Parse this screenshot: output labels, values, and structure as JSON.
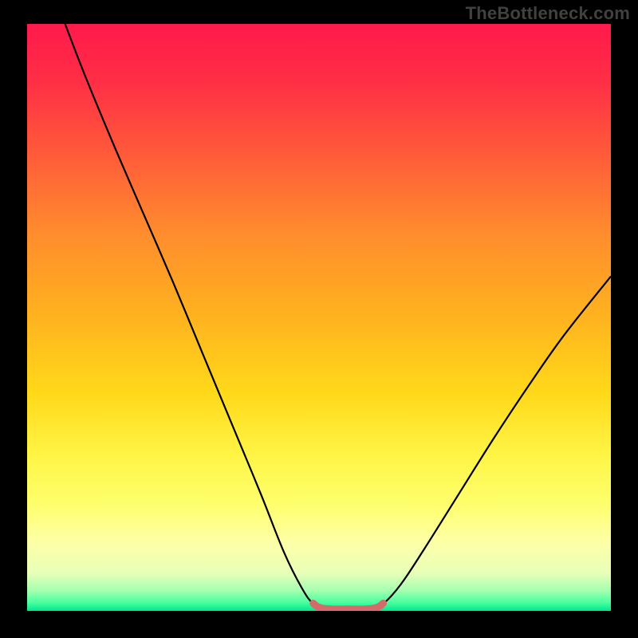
{
  "watermark": "TheBottleneck.com",
  "gradient": {
    "stops": [
      {
        "offset": 0.0,
        "color": "#ff1a4b"
      },
      {
        "offset": 0.1,
        "color": "#ff2f45"
      },
      {
        "offset": 0.22,
        "color": "#ff5a3a"
      },
      {
        "offset": 0.35,
        "color": "#ff8a2e"
      },
      {
        "offset": 0.5,
        "color": "#ffb31f"
      },
      {
        "offset": 0.63,
        "color": "#ffd91a"
      },
      {
        "offset": 0.74,
        "color": "#fff648"
      },
      {
        "offset": 0.82,
        "color": "#feff6e"
      },
      {
        "offset": 0.885,
        "color": "#fdffa8"
      },
      {
        "offset": 0.935,
        "color": "#e8ffb8"
      },
      {
        "offset": 0.965,
        "color": "#a6ffb0"
      },
      {
        "offset": 0.985,
        "color": "#4cffa0"
      },
      {
        "offset": 1.0,
        "color": "#00e88f"
      }
    ]
  },
  "chart_data": {
    "type": "line",
    "title": "",
    "xlabel": "",
    "ylabel": "",
    "xlim": [
      0,
      100
    ],
    "ylim": [
      0,
      100
    ],
    "series": [
      {
        "name": "bottleneck-curve",
        "color": "#000000",
        "width": 2.2,
        "points": [
          {
            "x": 6.5,
            "y": 100.0
          },
          {
            "x": 10.0,
            "y": 91.0
          },
          {
            "x": 15.0,
            "y": 79.0
          },
          {
            "x": 20.0,
            "y": 67.5
          },
          {
            "x": 25.0,
            "y": 56.0
          },
          {
            "x": 30.0,
            "y": 44.0
          },
          {
            "x": 35.0,
            "y": 32.0
          },
          {
            "x": 40.0,
            "y": 20.0
          },
          {
            "x": 44.0,
            "y": 10.0
          },
          {
            "x": 47.0,
            "y": 4.0
          },
          {
            "x": 49.0,
            "y": 1.2
          },
          {
            "x": 51.0,
            "y": 0.3
          },
          {
            "x": 55.0,
            "y": 0.2
          },
          {
            "x": 59.0,
            "y": 0.3
          },
          {
            "x": 61.0,
            "y": 1.2
          },
          {
            "x": 64.0,
            "y": 4.5
          },
          {
            "x": 68.0,
            "y": 10.5
          },
          {
            "x": 74.0,
            "y": 20.0
          },
          {
            "x": 80.0,
            "y": 29.5
          },
          {
            "x": 86.0,
            "y": 38.5
          },
          {
            "x": 92.0,
            "y": 47.0
          },
          {
            "x": 100.0,
            "y": 57.0
          }
        ]
      },
      {
        "name": "sweet-zone-marker",
        "color": "#d46a6a",
        "width": 9,
        "linecap": "round",
        "points": [
          {
            "x": 49.0,
            "y": 1.3
          },
          {
            "x": 50.0,
            "y": 0.6
          },
          {
            "x": 52.0,
            "y": 0.3
          },
          {
            "x": 55.0,
            "y": 0.3
          },
          {
            "x": 58.0,
            "y": 0.3
          },
          {
            "x": 60.0,
            "y": 0.6
          },
          {
            "x": 61.0,
            "y": 1.3
          }
        ]
      }
    ]
  }
}
